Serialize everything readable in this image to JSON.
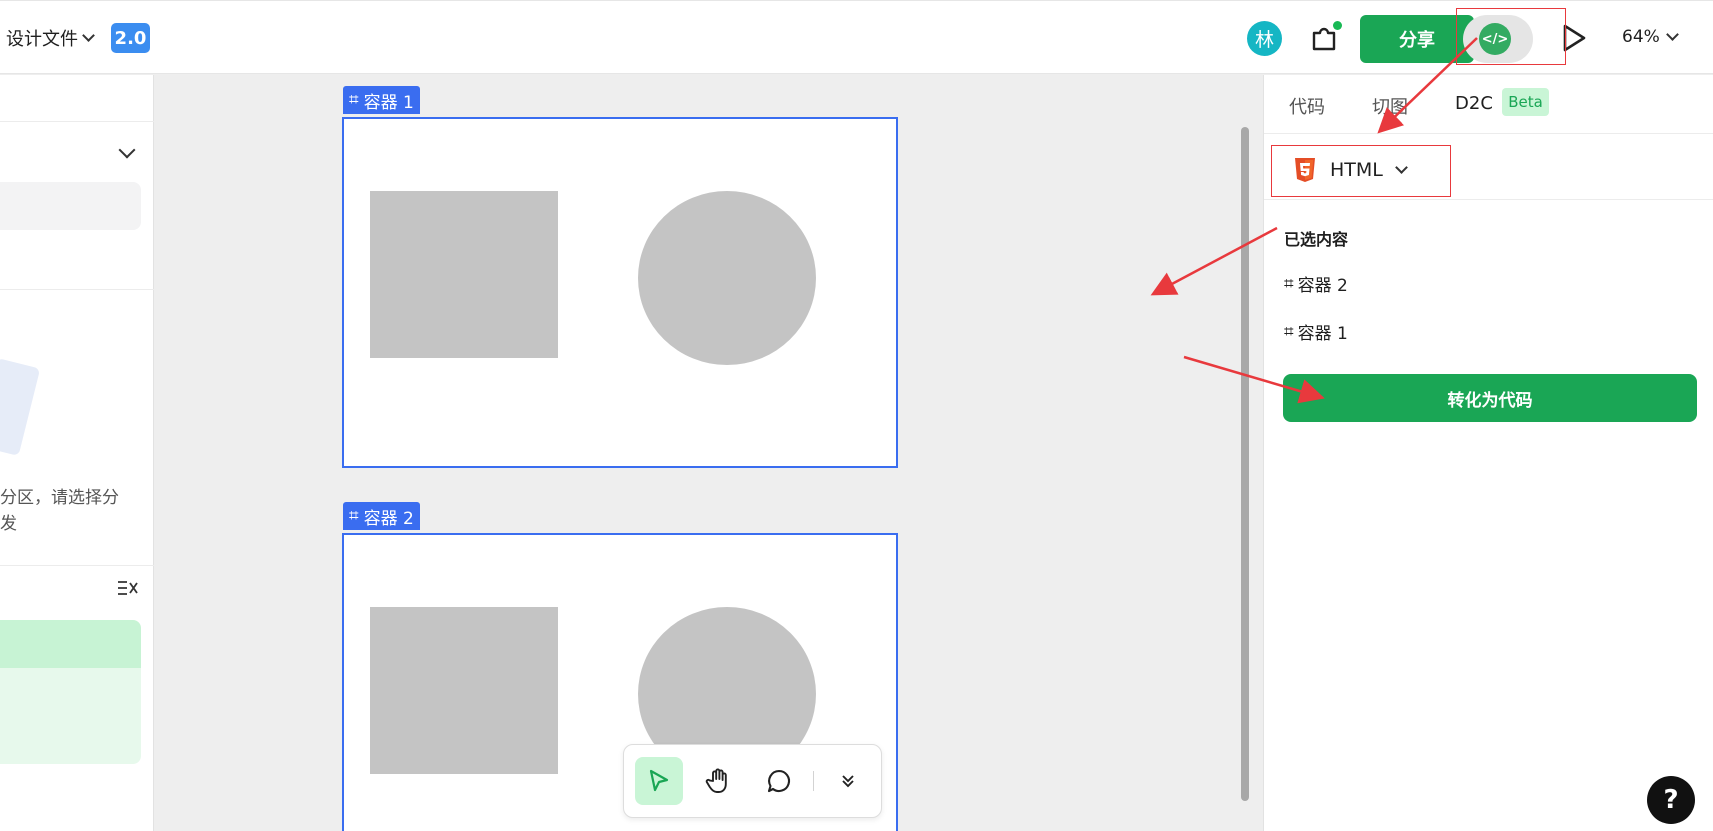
{
  "header": {
    "file_title": "设计文件",
    "version": "2.0",
    "avatar_initial": "林",
    "share_label": "分享",
    "code_toggle_label": "</>",
    "zoom_level": "64%"
  },
  "left_panel": {
    "notice_line1": "分区，请选择分",
    "notice_line2": "发",
    "clear_icon": "clear-list-icon"
  },
  "canvas": {
    "frames": [
      {
        "label": "容器 1"
      },
      {
        "label": "容器 2"
      }
    ]
  },
  "toolbar": {
    "tools": [
      "move-tool",
      "hand-tool",
      "comment-tool",
      "more-tools"
    ]
  },
  "right_panel": {
    "tabs": [
      {
        "label": "代码"
      },
      {
        "label": "切图"
      },
      {
        "label": "D2C"
      }
    ],
    "beta_label": "Beta",
    "language": "HTML",
    "section_title": "已选内容",
    "selected_items": [
      "容器 2",
      "容器 1"
    ],
    "convert_label": "转化为代码"
  },
  "help_label": "?",
  "colors": {
    "accent_green": "#1aa655",
    "frame_blue": "#3a6df0",
    "annotation_red": "#e8393d",
    "version_blue": "#3b8df0"
  }
}
